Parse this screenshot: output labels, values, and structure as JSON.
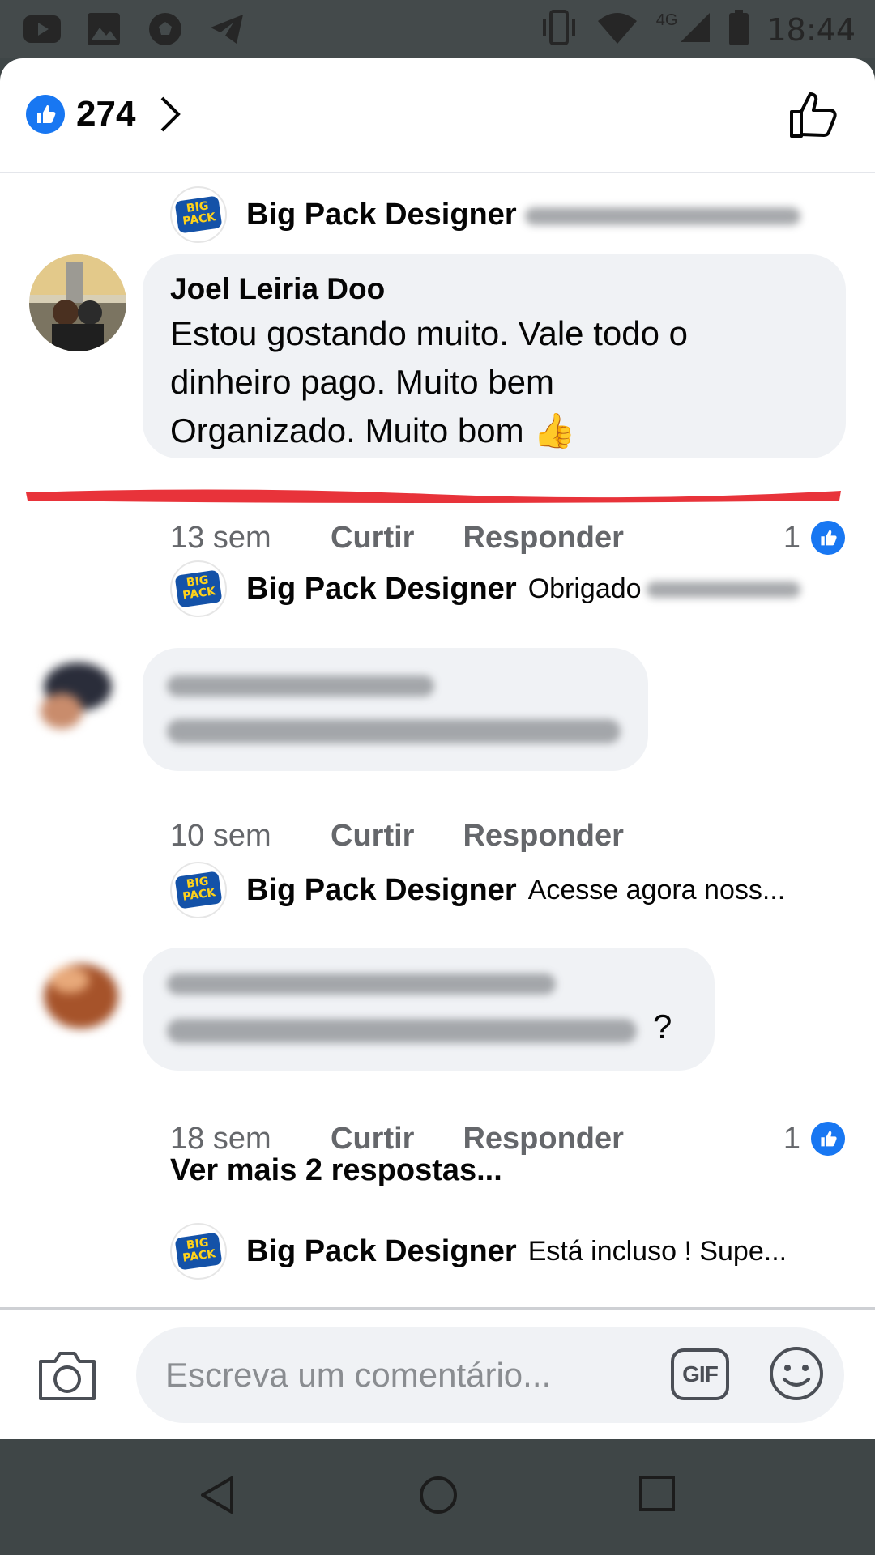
{
  "statusbar": {
    "network": "4G",
    "time": "18:44",
    "icons": [
      "youtube-icon",
      "image-icon",
      "soccer-ball-icon",
      "telegram-icon",
      "vibrate-icon",
      "wifi-icon",
      "signal-icon",
      "battery-icon"
    ]
  },
  "header": {
    "like_count": "274"
  },
  "brand": {
    "logo_text_1": "BIG",
    "logo_text_2": "PACK"
  },
  "comments": [
    {
      "type": "reply",
      "name": "Big Pack Designer",
      "text": ""
    },
    {
      "type": "comment",
      "name": "Joel Leiria Doo",
      "text": "Estou gostando muito. Vale todo o dinheiro pago. Muito bem Organizado. Muito bom 👍",
      "line1": "Estou gostando muito. Vale todo o",
      "line2": "dinheiro pago. Muito bem",
      "line3": "Organizado. Muito bom 👍",
      "time": "13 sem",
      "like": "Curtir",
      "reply": "Responder",
      "likes": "1"
    },
    {
      "type": "reply",
      "name": "Big Pack Designer",
      "text": "Obrigado"
    },
    {
      "type": "comment",
      "time": "10 sem",
      "like": "Curtir",
      "reply": "Responder"
    },
    {
      "type": "reply",
      "name": "Big Pack Designer",
      "text": "Acesse agora noss..."
    },
    {
      "type": "comment",
      "text_end": "?",
      "time": "18 sem",
      "like": "Curtir",
      "reply": "Responder",
      "likes": "1",
      "more_replies": "Ver mais 2 respostas..."
    },
    {
      "type": "reply",
      "name": "Big Pack Designer",
      "text": "Está incluso !  Supe..."
    }
  ],
  "composer": {
    "placeholder": "Escreva um comentário...",
    "gif_label": "GIF"
  },
  "colors": {
    "facebook_blue": "#1877f2",
    "bubble": "#f0f2f5",
    "secondary_text": "#65676b",
    "highlight": "#e8333a"
  }
}
